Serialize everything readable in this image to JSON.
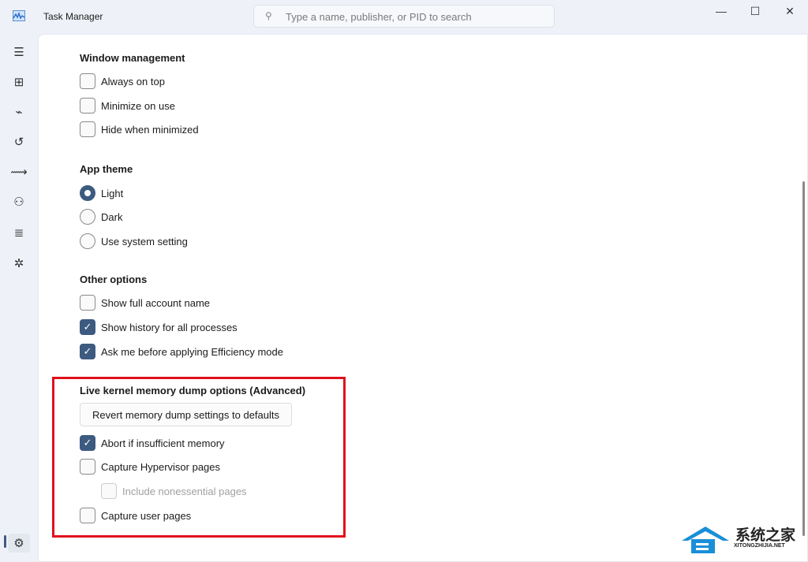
{
  "window": {
    "title": "Task Manager",
    "search_placeholder": "Type a name, publisher, or PID to search",
    "minimize": "—",
    "maximize": "☐",
    "close": "✕"
  },
  "sidebar": [
    "menu-icon",
    "processes-icon",
    "performance-icon",
    "app-history-icon",
    "startup-icon",
    "users-icon",
    "details-icon",
    "services-icon",
    "settings-icon"
  ],
  "sections": {
    "window_management": {
      "title": "Window management",
      "items": [
        {
          "label": "Always on top",
          "checked": false
        },
        {
          "label": "Minimize on use",
          "checked": false
        },
        {
          "label": "Hide when minimized",
          "checked": false
        }
      ]
    },
    "app_theme": {
      "title": "App theme",
      "options": [
        {
          "label": "Light",
          "selected": true
        },
        {
          "label": "Dark",
          "selected": false
        },
        {
          "label": "Use system setting",
          "selected": false
        }
      ]
    },
    "other_options": {
      "title": "Other options",
      "items": [
        {
          "label": "Show full account name",
          "checked": false
        },
        {
          "label": "Show history for all processes",
          "checked": true
        },
        {
          "label": "Ask me before applying Efficiency mode",
          "checked": true
        }
      ]
    },
    "dump": {
      "title": "Live kernel memory dump options (Advanced)",
      "revert_button": "Revert memory dump settings to defaults",
      "items": [
        {
          "label": "Abort if insufficient memory",
          "checked": true
        },
        {
          "label": "Capture Hypervisor pages",
          "checked": false
        },
        {
          "label": "Include nonessential pages",
          "checked": false,
          "disabled": true
        },
        {
          "label": "Capture user pages",
          "checked": false
        }
      ]
    }
  },
  "watermark": {
    "cn": "系统之家",
    "en": "XITONGZHIJIA.NET"
  },
  "colors": {
    "accent": "#3d5a80",
    "highlight": "#e0101c"
  }
}
